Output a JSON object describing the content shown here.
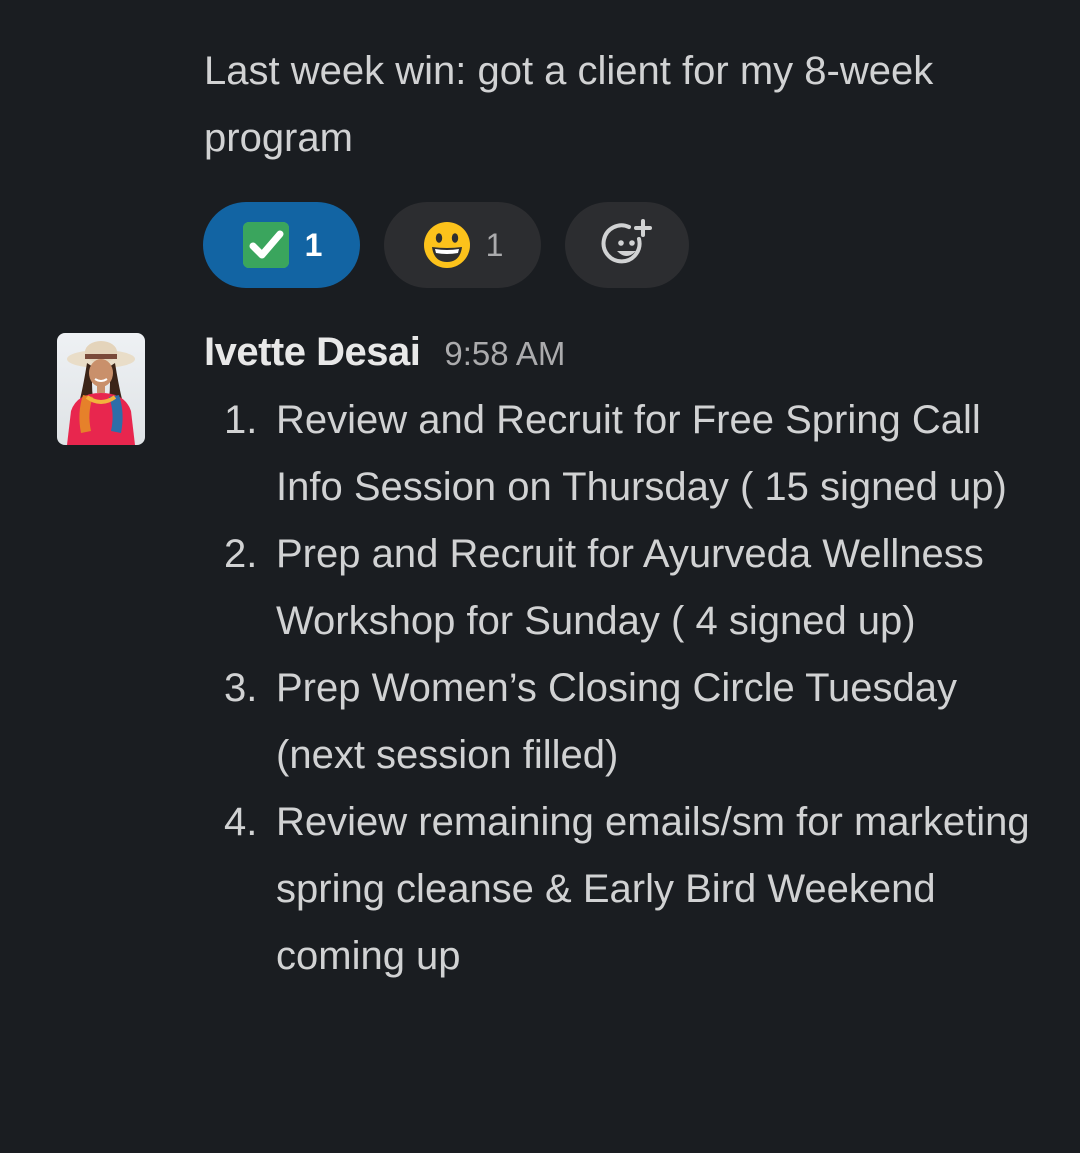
{
  "previous_message": {
    "text": "Last week win: got a client for my 8-week program"
  },
  "reactions": [
    {
      "emoji": "white-check-mark",
      "count": "1",
      "active": true
    },
    {
      "emoji": "grinning-face",
      "count": "1",
      "active": false
    }
  ],
  "add_reaction": {
    "icon": "add-reaction-icon"
  },
  "message": {
    "sender": "Ivette Desai",
    "timestamp": "9:58 AM",
    "items": [
      {
        "num": "1.",
        "text": "Review and Recruit for Free Spring Call Info Session on Thursday ( 15 signed up)"
      },
      {
        "num": "2.",
        "text": "Prep and Recruit for Ayurveda Wellness Workshop for Sunday ( 4 signed up)"
      },
      {
        "num": "3.",
        "text": "Prep Women’s Closing Circle Tuesday (next session filled)"
      },
      {
        "num": "4.",
        "text": "Review remaining emails/sm for marketing spring cleanse & Early Bird Weekend coming up"
      }
    ]
  },
  "colors": {
    "background": "#1a1d21",
    "active_reaction": "#1264a3",
    "inactive_reaction": "#2c2d30",
    "text": "#d1d2d3",
    "muted": "#ababad"
  }
}
